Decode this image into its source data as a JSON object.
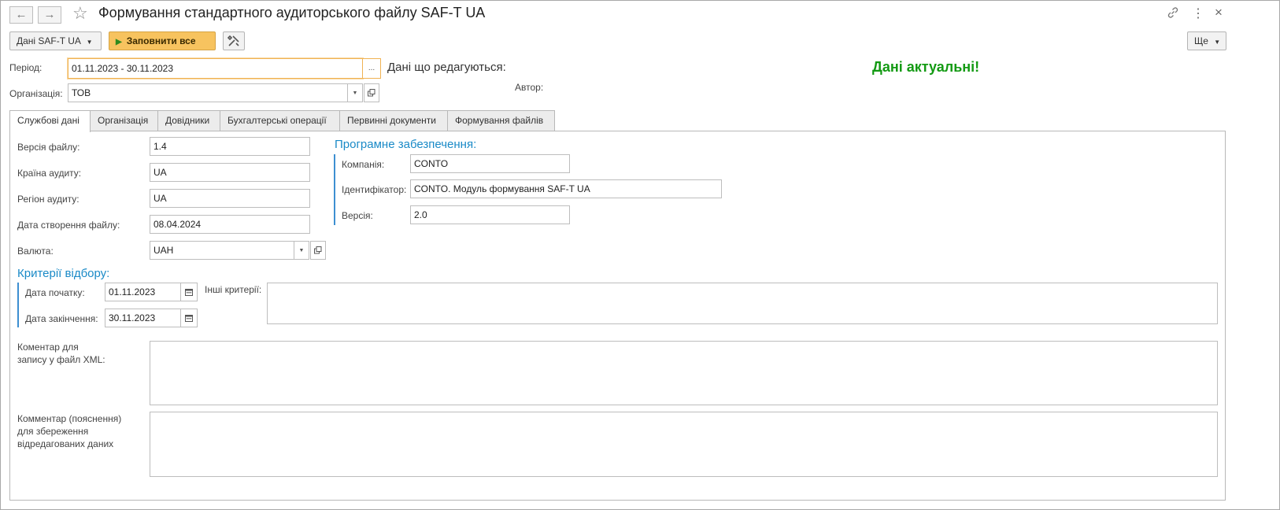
{
  "window": {
    "title": "Формування стандартного аудиторського файлу SAF-T UA",
    "back_icon": "←",
    "forward_icon": "→",
    "star_icon": "☆",
    "link_icon": "🔗",
    "menu_icon": "⋮",
    "close_icon": "×"
  },
  "toolbar": {
    "data_menu_label": "Дані SAF-T UA",
    "fill_all_label": "Заповнити все",
    "more_label": "Ще"
  },
  "header": {
    "period_label": "Період:",
    "period_value": "01.11.2023 - 30.11.2023",
    "period_btn": "...",
    "edited_label": "Дані що редагуються:",
    "author_label": "Автор:",
    "status_text": "Дані актуальні!",
    "org_label": "Організація:",
    "org_value": "ТОВ"
  },
  "tabs": [
    {
      "label": "Службові дані"
    },
    {
      "label": "Організація"
    },
    {
      "label": "Довідники"
    },
    {
      "label": "Бухгалтерські операції"
    },
    {
      "label": "Первинні документи"
    },
    {
      "label": "Формування файлів"
    }
  ],
  "service": {
    "file_version_label": "Версія файлу:",
    "file_version": "1.4",
    "country_label": "Країна аудиту:",
    "country": "UA",
    "region_label": "Регіон аудиту:",
    "region": "UA",
    "created_label": "Дата створення файлу:",
    "created": "08.04.2024",
    "currency_label": "Валюта:",
    "currency": "UAH"
  },
  "software": {
    "title": "Програмне забезпечення:",
    "company_label": "Компанія:",
    "company": "CONTO",
    "id_label": "Ідентифікатор:",
    "id": "CONTO. Модуль формування SAF-T UA",
    "version_label": "Версія:",
    "version": "2.0"
  },
  "criteria": {
    "title": "Критерії відбору:",
    "start_label": "Дата початку:",
    "start": "01.11.2023",
    "end_label": "Дата закінчення:",
    "end": "30.11.2023",
    "other_label": "Інші критерії:"
  },
  "comments": {
    "xml_label_1": "Коментар для",
    "xml_label_2": "запису у файл XML:",
    "edit_label_1": "Комментар (пояснення)",
    "edit_label_2": "для збереження",
    "edit_label_3": "відредагованих даних"
  },
  "colors": {
    "accent": "#1a8ac7",
    "status_green": "#139a13",
    "fill_button": "#f7c35f"
  }
}
